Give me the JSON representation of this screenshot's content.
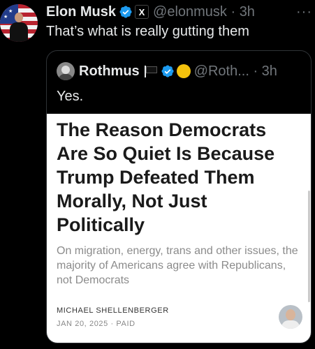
{
  "author": {
    "display_name": "Elon Musk",
    "handle_time": "@elonmusk · 3h",
    "affiliation_badge": "X"
  },
  "tweet": {
    "text": "That’s what is really gutting them"
  },
  "menu": {
    "more_label": "···"
  },
  "quote": {
    "display_name": "Rothmus",
    "handle_time": "@Roth... · 3h",
    "text": "Yes."
  },
  "card": {
    "title": "The Reason Democrats Are So Quiet Is Because Trump Defeated Them Morally, Not Just Politically",
    "subtitle": "On migration, energy, trans and other issues, the majority of Americans agree with Republicans, not Democrats",
    "author": "MICHAEL SHELLENBERGER",
    "date": "JAN 20, 2025 · PAID"
  },
  "colors": {
    "background": "#000000",
    "text_primary": "#e7e9ea",
    "text_secondary": "#71767b",
    "verified_blue": "#1d9bf0",
    "card_background": "#ffffff"
  }
}
